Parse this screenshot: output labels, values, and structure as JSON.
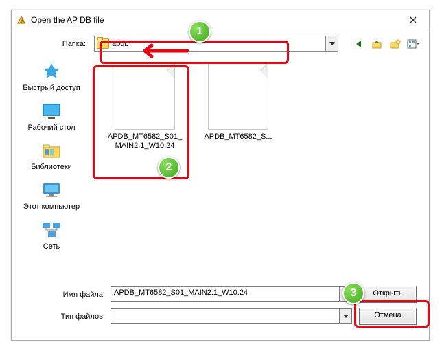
{
  "window": {
    "title": "Open the AP DB file"
  },
  "toolbar": {
    "folder_label": "Папка:",
    "folder_name": "apdb"
  },
  "places": [
    {
      "label": "Быстрый доступ"
    },
    {
      "label": "Рабочий стол"
    },
    {
      "label": "Библиотеки"
    },
    {
      "label": "Этот компьютер"
    },
    {
      "label": "Сеть"
    }
  ],
  "files": [
    {
      "name": "APDB_MT6582_S01_MAIN2.1_W10.24"
    },
    {
      "name": "APDB_MT6582_S..."
    }
  ],
  "bottom": {
    "filename_label": "Имя файла:",
    "filename_value": "APDB_MT6582_S01_MAIN2.1_W10.24",
    "filetype_label": "Тип файлов:",
    "filetype_value": "",
    "open_btn": "Открыть",
    "cancel_btn": "Отмена"
  },
  "markers": {
    "m1": "1",
    "m2": "2",
    "m3": "3"
  }
}
